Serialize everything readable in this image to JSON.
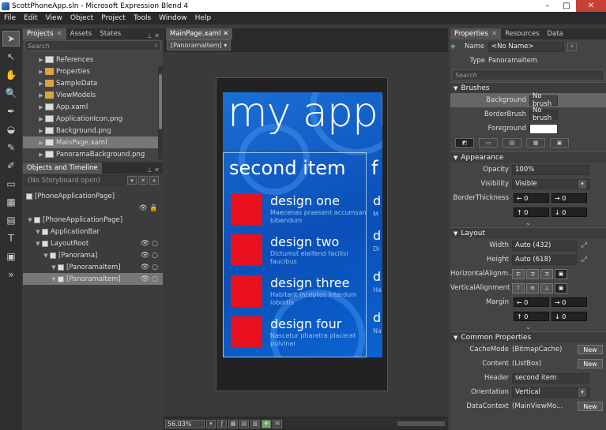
{
  "window": {
    "title": "ScottPhoneApp.sln - Microsoft Expression Blend 4",
    "min": "–",
    "max": "□",
    "close": "✕"
  },
  "menu": [
    "File",
    "Edit",
    "View",
    "Object",
    "Project",
    "Tools",
    "Window",
    "Help"
  ],
  "projects_panel": {
    "tabs": [
      "Projects",
      "Assets",
      "States"
    ],
    "search_placeholder": "Search",
    "items": [
      {
        "label": "References",
        "type": "doc",
        "sel": false
      },
      {
        "label": "Properties",
        "type": "folder",
        "sel": false
      },
      {
        "label": "SampleData",
        "type": "folder",
        "sel": false
      },
      {
        "label": "ViewModels",
        "type": "folder",
        "sel": false
      },
      {
        "label": "App.xaml",
        "type": "doc",
        "sel": false
      },
      {
        "label": "ApplicationIcon.png",
        "type": "doc",
        "sel": false
      },
      {
        "label": "Background.png",
        "type": "doc",
        "sel": false
      },
      {
        "label": "MainPage.xaml",
        "type": "doc",
        "sel": true
      },
      {
        "label": "PanoramaBackground.png",
        "type": "doc",
        "sel": false
      }
    ]
  },
  "objects_panel": {
    "title": "Objects and Timeline",
    "storyboard": "(No Storyboard open)",
    "root": "[PhoneApplicationPage]",
    "items": [
      {
        "label": "[PhoneApplicationPage]",
        "indent": 0,
        "eye": false
      },
      {
        "label": "ApplicationBar",
        "indent": 1,
        "eye": false
      },
      {
        "label": "LayoutRoot",
        "indent": 1,
        "eye": true
      },
      {
        "label": "[Panorama]",
        "indent": 2,
        "eye": true
      },
      {
        "label": "[PanoramaItem]",
        "indent": 3,
        "eye": true
      },
      {
        "label": "[PanoramaItem]",
        "indent": 3,
        "eye": true,
        "sel": true
      }
    ]
  },
  "document": {
    "tab": "MainPage.xaml",
    "crumb": "[PanoramaItem] ▾",
    "zoom": "56.03%"
  },
  "phone": {
    "app_title": "my application",
    "section": "second item",
    "section2": "f",
    "items": [
      {
        "title": "design one",
        "desc": "Maecenas praesent accumsan bibendum"
      },
      {
        "title": "design two",
        "desc": "Dictumst eleifend facilisi faucibus"
      },
      {
        "title": "design three",
        "desc": "Habitant inceptos interdum lobortis"
      },
      {
        "title": "design four",
        "desc": "Nascetur pharetra placerat pulvinar"
      }
    ],
    "col2": [
      "d",
      "d",
      "d",
      "d"
    ],
    "col2s": [
      "M",
      "Di",
      "Ha",
      "Na"
    ]
  },
  "properties": {
    "tabs": [
      "Properties",
      "Resources",
      "Data"
    ],
    "name_label": "Name",
    "name_value": "<No Name>",
    "type_label": "Type",
    "type_value": "PanoramaItem",
    "search_placeholder": "Search",
    "brushes": {
      "title": "Brushes",
      "rows": [
        {
          "label": "Background",
          "value": "No brush"
        },
        {
          "label": "BorderBrush",
          "value": "No brush"
        },
        {
          "label": "Foreground",
          "value": ""
        }
      ]
    },
    "appearance": {
      "title": "Appearance",
      "opacity_label": "Opacity",
      "opacity": "100%",
      "visibility_label": "Visibility",
      "visibility": "Visible",
      "border_label": "BorderThickness",
      "border": [
        "0",
        "0",
        "0",
        "0"
      ]
    },
    "layout": {
      "title": "Layout",
      "width_label": "Width",
      "width": "Auto (432)",
      "height_label": "Height",
      "height": "Auto (618)",
      "halign_label": "HorizontalAlignm...",
      "valign_label": "VerticalAlignment",
      "margin_label": "Margin",
      "margin": [
        "0",
        "0",
        "0",
        "0"
      ]
    },
    "common": {
      "title": "Common Properties",
      "rows": [
        {
          "label": "CacheMode",
          "value": "(BitmapCache)",
          "btn": "New"
        },
        {
          "label": "Content",
          "value": "(ListBox)",
          "btn": "New"
        },
        {
          "label": "Header",
          "value": "second item",
          "btn": ""
        },
        {
          "label": "Orientation",
          "value": "Vertical",
          "btn": ""
        },
        {
          "label": "DataContext",
          "value": "(MainViewMo...",
          "btn": "New"
        }
      ]
    }
  }
}
